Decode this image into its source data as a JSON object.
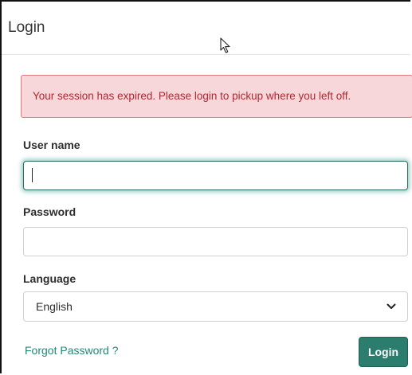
{
  "dialog": {
    "title": "Login"
  },
  "alert": {
    "message": "Your session has expired. Please login to pickup where you left off.",
    "colors": {
      "background": "#f8d7da",
      "border": "#e0787e",
      "text": "#b0282f"
    }
  },
  "form": {
    "username": {
      "label": "User name",
      "value": "",
      "focused": true
    },
    "password": {
      "label": "Password",
      "value": ""
    },
    "language": {
      "label": "Language",
      "selected": "English"
    },
    "forgot_password": "Forgot Password ?",
    "login_button": "Login"
  },
  "icons": {
    "cursor": "mouse-pointer-icon",
    "dropdown": "chevron-down-icon"
  },
  "colors": {
    "accent": "#2b7d6e",
    "link": "#25877a",
    "focus_glow": "#3f9e8f"
  }
}
